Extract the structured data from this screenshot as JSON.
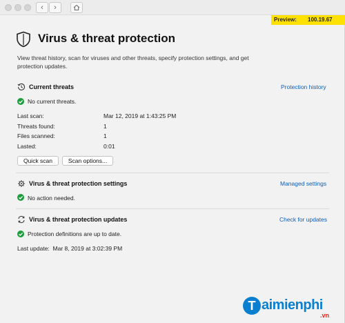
{
  "preview_banner": {
    "label": "Preview:",
    "version": "100.19.67"
  },
  "header": {
    "title": "Virus & threat protection",
    "description": "View threat history, scan for viruses and other threats, specify protection settings, and get protection updates."
  },
  "current_threats": {
    "title": "Current threats",
    "link": "Protection history",
    "status": "No current threats.",
    "details": [
      {
        "label": "Last scan:",
        "value": "Mar 12, 2019 at 1:43:25 PM"
      },
      {
        "label": "Threats found:",
        "value": "1"
      },
      {
        "label": "Files scanned:",
        "value": "1"
      },
      {
        "label": "Lasted:",
        "value": "0:01"
      }
    ],
    "quick_scan_label": "Quick scan",
    "scan_options_label": "Scan options..."
  },
  "settings": {
    "title": "Virus & threat protection settings",
    "link": "Managed settings",
    "status": "No action needed."
  },
  "updates": {
    "title": "Virus & threat protection updates",
    "link": "Check for updates",
    "status": "Protection definitions are up to date.",
    "last_update": "Last update:  Mar 8, 2019 at 3:02:39 PM"
  },
  "watermark": {
    "brand": "aimienphi",
    "initial": "T",
    "suffix": ".vn"
  },
  "colors": {
    "accent_link": "#0a5dba",
    "ok_green": "#1a9e3a",
    "preview_yellow": "#ffe100"
  },
  "icons": {
    "shield": "shield-icon",
    "history": "history-clock-icon",
    "settings": "gear-shield-icon",
    "updates": "refresh-icon",
    "check": "check-circle-icon",
    "back": "chevron-left-icon",
    "forward": "chevron-right-icon",
    "home": "home-icon"
  }
}
